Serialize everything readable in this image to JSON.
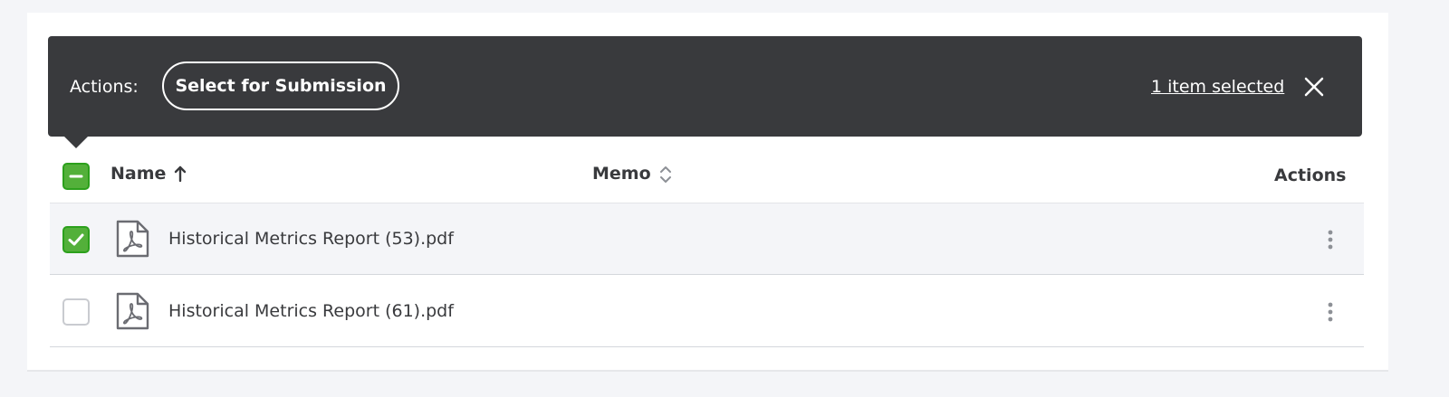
{
  "action_bar": {
    "actions_label": "Actions:",
    "submit_button_label": "Select for Submission",
    "selected_count_label": "1 item selected"
  },
  "table": {
    "columns": {
      "name": "Name",
      "memo": "Memo",
      "actions": "Actions"
    },
    "sort": {
      "name_icon": "arrow-up-icon",
      "memo_icon": "sort-updown-icon"
    },
    "rows": [
      {
        "file_name": "Historical Metrics Report (53).pdf",
        "selected": true,
        "icon": "pdf-file-icon"
      },
      {
        "file_name": "Historical Metrics Report (61).pdf",
        "selected": false,
        "icon": "pdf-file-icon"
      }
    ]
  },
  "colors": {
    "action_bar_bg": "#393a3d",
    "checkbox_green": "#53b03a",
    "selected_row_bg": "#f4f5f8"
  }
}
